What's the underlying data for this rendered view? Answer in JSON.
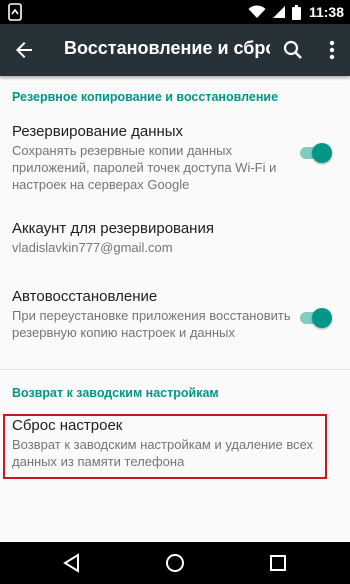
{
  "status_bar": {
    "time": "11:38"
  },
  "app_bar": {
    "title": "Восстановление и сброс",
    "back_icon": "arrow-back-icon",
    "search_icon": "search-icon",
    "more_icon": "more-vert-icon"
  },
  "sections": [
    {
      "header": "Резервное копирование и восстановление",
      "items": [
        {
          "title": "Резервирование данных",
          "summary": "Сохранять резервные копии данных приложений, паролей точек доступа Wi-Fi и настроек на серверах Google",
          "toggle": true
        },
        {
          "title": "Аккаунт для резервирования",
          "summary": "vladislavkin777@gmail.com"
        },
        {
          "title": "Автовосстановление",
          "summary": "При переустановке приложения восстановить резервную копию настроек и данных",
          "toggle": true
        }
      ]
    },
    {
      "header": "Возврат к заводским настройкам",
      "items": [
        {
          "title": "Сброс настроек",
          "summary": "Возврат к заводским настройкам и удаление всех данных из памяти телефона"
        }
      ]
    }
  ],
  "colors": {
    "accent": "#009688",
    "app_bar": "#263238",
    "highlight": "#c8171e"
  }
}
